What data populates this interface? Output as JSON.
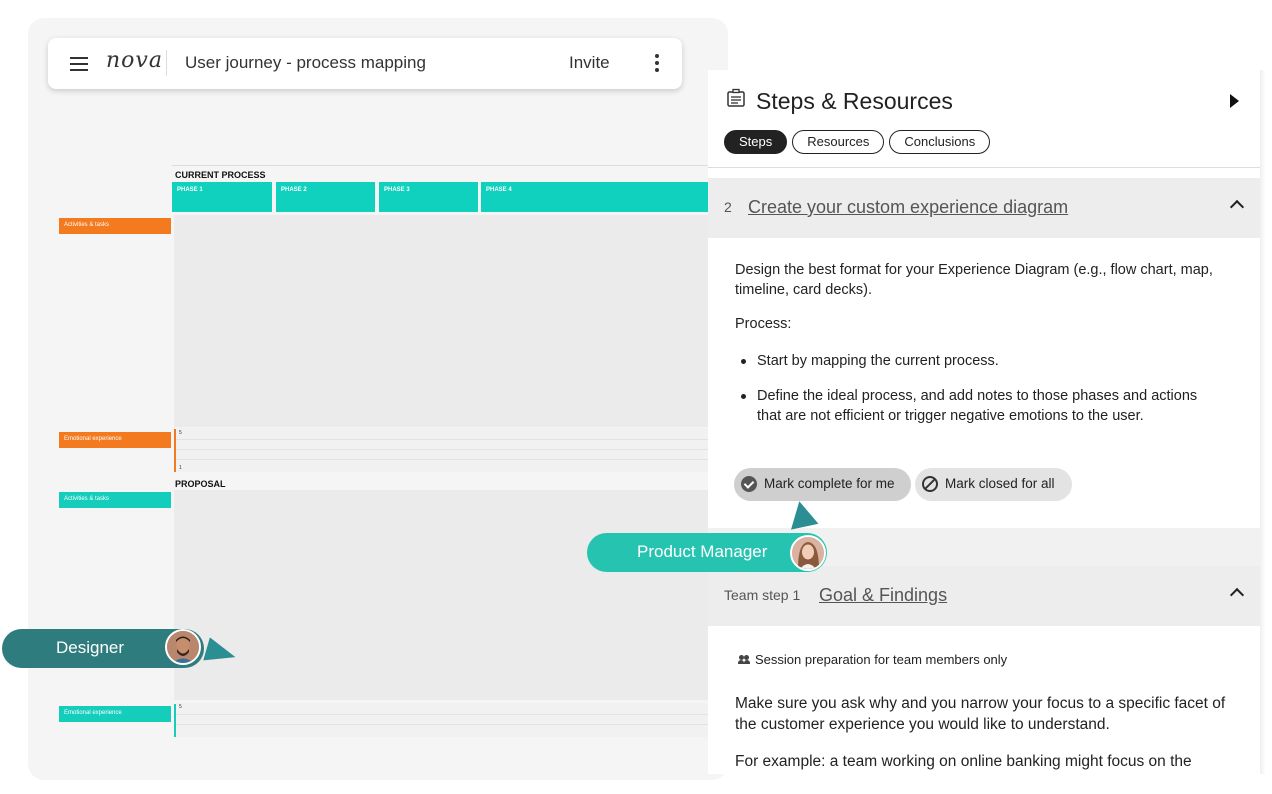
{
  "app": {
    "logo_text": "nova",
    "doc_title": "User journey - process mapping",
    "invite_label": "Invite"
  },
  "board": {
    "current_label": "CURRENT PROCESS",
    "proposal_label": "PROPOSAL",
    "phases": [
      "PHASE 1",
      "PHASE 2",
      "PHASE 3",
      "PHASE 4"
    ],
    "row_tags": {
      "activities_current": "Activities & tasks",
      "emotional_current": "Emotional experience",
      "activities_proposal": "Activities & tasks",
      "emotional_proposal": "Emotional experience"
    },
    "emo_scale": {
      "top": "5",
      "bottom": "1",
      "top2": "5"
    },
    "colors": {
      "phase": "#0fd1bd",
      "orange": "#f37a1e",
      "teal": "#14cdbb"
    }
  },
  "panel": {
    "title": "Steps & Resources",
    "tabs": [
      {
        "label": "Steps",
        "active": true
      },
      {
        "label": "Resources",
        "active": false
      },
      {
        "label": "Conclusions",
        "active": false
      }
    ],
    "step2": {
      "number": "2",
      "title": "Create your custom experience diagram",
      "intro": "Design the best format for your Experience Diagram (e.g., flow chart, map, timeline, card decks).",
      "process_label": "Process:",
      "bullets": [
        "Start by mapping the current process.",
        "Define the ideal process, and add notes to those phases and actions that are not efficient or trigger negative emotions to the user."
      ],
      "mark_complete_label": "Mark complete for me",
      "mark_closed_label": "Mark closed for all"
    },
    "team_step": {
      "number": "Team step 1",
      "title": "Goal & Findings",
      "note": "Session preparation for team members only",
      "para1": "Make sure you ask why and you narrow your focus to a specific facet of the customer experience you would like to understand.",
      "para2": "For example: a team working on online banking might focus on the"
    }
  },
  "cursors": {
    "product_manager": "Product Manager",
    "designer": "Designer"
  }
}
